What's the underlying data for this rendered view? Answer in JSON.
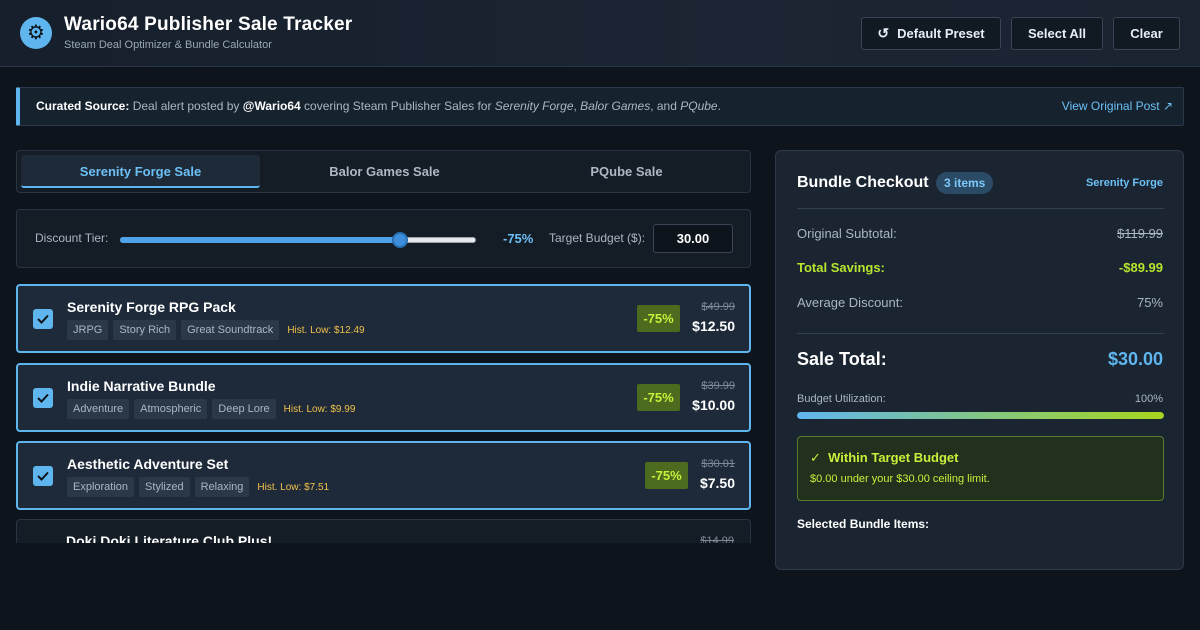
{
  "header": {
    "logo_glyph": "⚙",
    "title": "Wario64 Publisher Sale Tracker",
    "subtitle": "Steam Deal Optimizer & Bundle Calculator",
    "buttons": {
      "preset_icon": "↺",
      "preset": "Default Preset",
      "select_all": "Select All",
      "clear": "Clear"
    }
  },
  "source": {
    "label": "Curated Source:",
    "t1": " Deal alert posted by ",
    "handle": "@Wario64",
    "t2": " covering Steam Publisher Sales for ",
    "pub1": "Serenity Forge",
    "sep1": ", ",
    "pub2": "Balor Games",
    "sep2": ", and ",
    "pub3": "PQube",
    "end": ".",
    "link": "View Original Post ↗"
  },
  "tabs": [
    {
      "label": "Serenity Forge Sale",
      "active": true
    },
    {
      "label": "Balor Games Sale",
      "active": false
    },
    {
      "label": "PQube Sale",
      "active": false
    }
  ],
  "discount": {
    "label": "Discount Tier:",
    "slider_fraction": 0.8,
    "value_label": "-75%",
    "budget_label": "Target Budget ($):",
    "budget_value": "30.00"
  },
  "items": [
    {
      "name": "Serenity Forge RPG Pack",
      "tags": [
        "JRPG",
        "Story Rich",
        "Great Soundtrack"
      ],
      "hist": "Hist. Low: $12.49",
      "discount": "-75%",
      "orig": "$49.99",
      "sale": "$12.50",
      "selected": true
    },
    {
      "name": "Indie Narrative Bundle",
      "tags": [
        "Adventure",
        "Atmospheric",
        "Deep Lore"
      ],
      "hist": "Hist. Low: $9.99",
      "discount": "-75%",
      "orig": "$39.99",
      "sale": "$10.00",
      "selected": true
    },
    {
      "name": "Aesthetic Adventure Set",
      "tags": [
        "Exploration",
        "Stylized",
        "Relaxing"
      ],
      "hist": "Hist. Low: $7.51",
      "discount": "-75%",
      "orig": "$30.01",
      "sale": "$7.50",
      "selected": true
    },
    {
      "name": "Doki Doki Literature Club Plus!",
      "tags": [],
      "hist": "",
      "discount": "",
      "orig": "$14.99",
      "sale": "",
      "selected": false
    }
  ],
  "checkout": {
    "title": "Bundle Checkout",
    "count": "3 items",
    "publisher": "Serenity Forge",
    "subtotal_label": "Original Subtotal:",
    "subtotal_value": "$119.99",
    "savings_label": "Total Savings:",
    "savings_value": "-$89.99",
    "avg_label": "Average Discount:",
    "avg_value": "75%",
    "total_label": "Sale Total:",
    "total_value": "$30.00",
    "util_label": "Budget Utilization:",
    "util_value": "100%",
    "util_fraction": 1.0,
    "budget_title": "Within Target Budget",
    "budget_check": "✓",
    "budget_text": "$0.00 under your $30.00 ceiling limit.",
    "selected_label": "Selected Bundle Items:"
  }
}
